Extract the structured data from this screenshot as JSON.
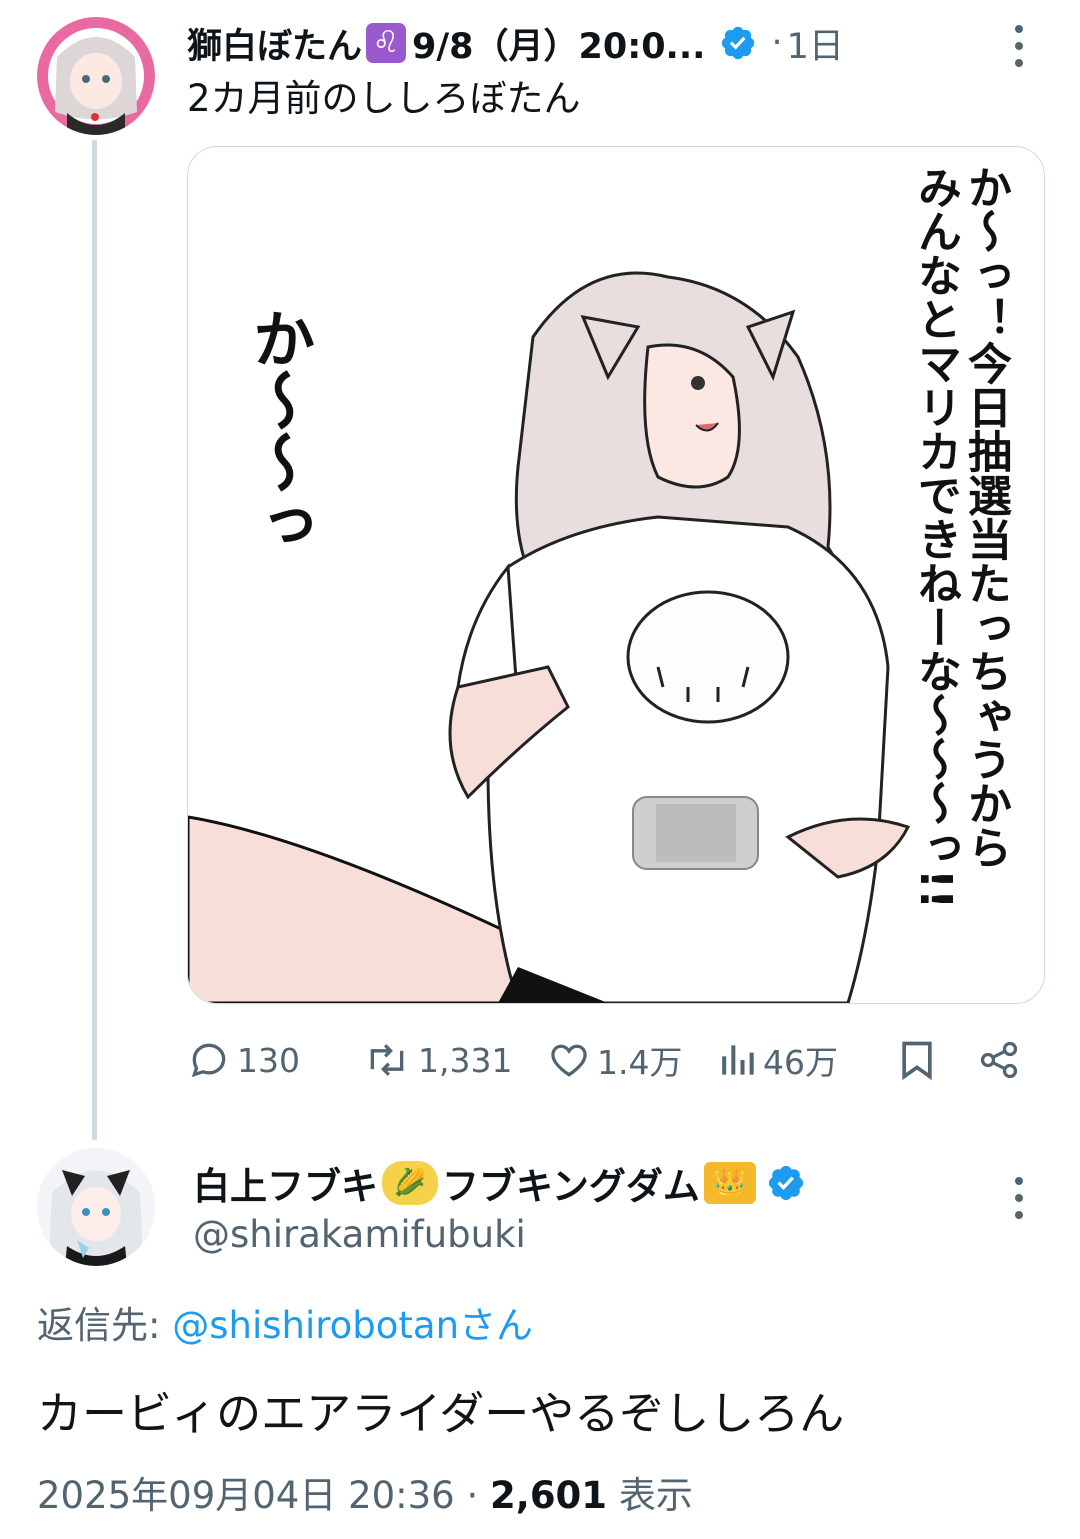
{
  "tweet1": {
    "author": "獅白ぼたん",
    "emoji": "♌",
    "date_partial": "9/8（月）20:0...",
    "separator": "·",
    "age": "1日",
    "body": "2カ月前のししろぼたん",
    "media": {
      "left_text": "か〜〜っ",
      "right_col1": "か〜っ！今日抽選当たっちゃうから",
      "right_col2": "みんなとマリカできねーな〜〜〜っ!!"
    },
    "actions": {
      "replies": "130",
      "reposts": "1,331",
      "likes": "1.4万",
      "views": "46万"
    }
  },
  "tweet2": {
    "author": "白上フブキ",
    "corn_emoji": "🌽",
    "author_suffix": "フブキングダム",
    "crown_emoji": "👑",
    "handle": "@shirakamifubuki",
    "reply_to_label": "返信先:",
    "reply_to_handle": "@shishirobotanさん",
    "body": "カービィのエアライダーやるぞししろん",
    "timestamp": "2025年09月04日 20:36",
    "separator": "·",
    "views_count": "2,601",
    "views_label": "表示"
  },
  "colors": {
    "text": "#0f1419",
    "muted": "#536471",
    "link": "#1d9bf0",
    "verified": "#1d9bf0",
    "border": "#cfd9de"
  }
}
